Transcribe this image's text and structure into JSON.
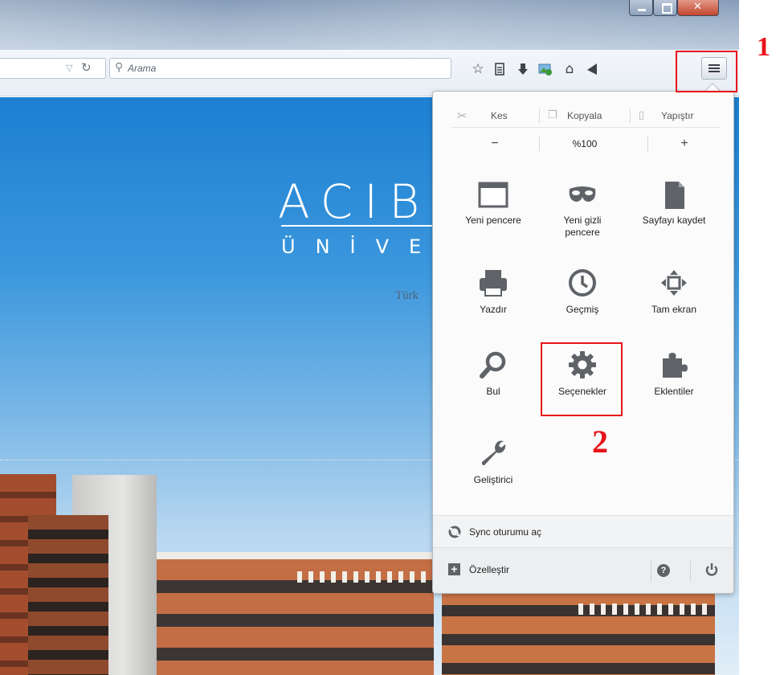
{
  "toolbar": {
    "search_placeholder": "Arama"
  },
  "page": {
    "logo_text": "ACIB",
    "logo_subtext": "ÜNİVE",
    "tagline": "Türk"
  },
  "menu": {
    "edit": {
      "cut": "Kes",
      "copy": "Kopyala",
      "paste": "Yapıştır"
    },
    "zoom": {
      "out": "−",
      "level": "%100",
      "in": "+"
    },
    "grid": [
      {
        "label": "Yeni pencere"
      },
      {
        "label": "Yeni gizli\npencere"
      },
      {
        "label": "Sayfayı kaydet"
      },
      {
        "label": "Yazdır"
      },
      {
        "label": "Geçmiş"
      },
      {
        "label": "Tam ekran"
      },
      {
        "label": "Bul"
      },
      {
        "label": "Seçenekler"
      },
      {
        "label": "Eklentiler"
      },
      {
        "label": "Geliştirici"
      }
    ],
    "sync": "Sync oturumu aç",
    "customize": "Özelleştir"
  },
  "annotations": {
    "step1": "1",
    "step2": "2",
    "color": "#e8141b"
  }
}
